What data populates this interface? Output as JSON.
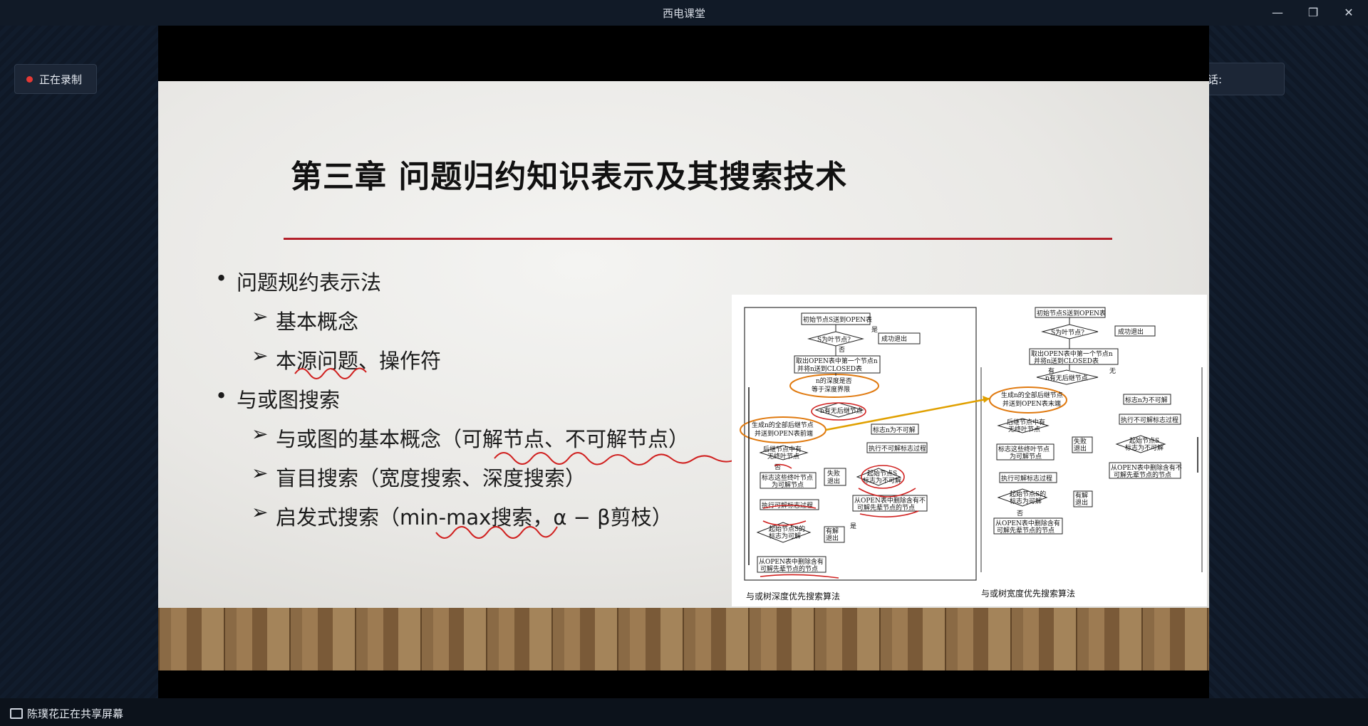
{
  "window": {
    "title": "西电课堂",
    "min_icon": "minimize-icon",
    "restore_icon": "restore-icon",
    "close_icon": "close-icon"
  },
  "recording": {
    "label": "正在录制",
    "dot_color": "#e53935"
  },
  "speaker": {
    "label": "正在讲话:"
  },
  "share_status": {
    "label": "陈璞花正在共享屏幕"
  },
  "slide": {
    "title": "第三章 问题归约知识表示及其搜索技术",
    "accent_color": "#b3202a",
    "bullets": [
      {
        "text": "问题规约表示法",
        "subs": [
          "基本概念",
          "本源问题、操作符"
        ]
      },
      {
        "text": "与或图搜索",
        "subs": [
          "与或图的基本概念（可解节点、不可解节点）",
          "盲目搜索（宽度搜索、深度搜索）",
          "启发式搜索（min-max搜索，α − β剪枝）"
        ]
      }
    ],
    "flowchart": {
      "caption_left": "与或树深度优先搜索算法",
      "caption_right": "与或树宽度优先搜索算法",
      "left_nodes": [
        "初始节点S送到OPEN表",
        "S为叶节点?",
        "成功退出",
        "取出OPEN表中第一个节点n",
        "并将n送到CLOSED表",
        "n的深度是否",
        "等于深度界限",
        "n有无后继节点",
        "生成n的全部后继节点",
        "并送到OPEN表前端",
        "标志n为不可解",
        "后继节点中有",
        "无终叶节点",
        "执行不可解标志过程",
        "标志这些终叶节点",
        "为可解节点",
        "失败",
        "退出",
        "起始节点S",
        "标志为不可解",
        "执行可解标志过程",
        "从OPEN表中删除含有不",
        "可解先辈节点的节点",
        "起始节点S的",
        "标志为可解",
        "有解",
        "退出",
        "从OPEN表中删除含有",
        "可解先辈节点的节点"
      ],
      "right_nodes": [
        "初始节点S送到OPEN表",
        "S为叶节点?",
        "成功退出",
        "取出OPEN表中第一个节点n",
        "并将n送到CLOSED表",
        "n有无后继节点",
        "生成n的全部后继节点",
        "并送到OPEN表末端",
        "标志n为不可解",
        "后继节点中有",
        "无终叶节点",
        "执行不可解标志过程",
        "标志这些终叶节点",
        "为可解节点",
        "失败",
        "退出",
        "起始节点S",
        "标志为不可解",
        "执行可解标志过程",
        "从OPEN表中删除含有不",
        "可解先辈节点的节点",
        "起始节点S的",
        "标志为可解",
        "有解",
        "退出",
        "从OPEN表中删除含有",
        "可解先辈节点的节点"
      ],
      "branch_labels": [
        "是",
        "否",
        "有",
        "无",
        "否",
        "是",
        "否"
      ]
    }
  },
  "icons": {
    "screen_share": "screen-share-icon",
    "record": "record-dot-icon"
  }
}
